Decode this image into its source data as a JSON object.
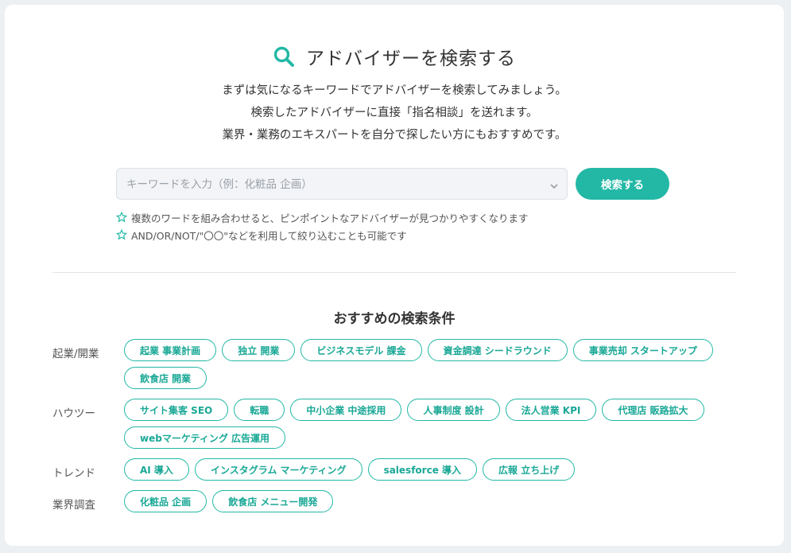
{
  "header": {
    "title": "アドバイザーを検索する",
    "description_lines": [
      "まずは気になるキーワードでアドバイザーを検索してみましょう。",
      "検索したアドバイザーに直接「指名相談」を送れます。",
      "業界・業務のエキスパートを自分で探したい方にもおすすめです。"
    ],
    "icon": "search-icon"
  },
  "search": {
    "placeholder": "キーワードを入力（例：化粧品 企画）",
    "value": "",
    "button_label": "検索する"
  },
  "tips": [
    "複数のワードを組み合わせると、ピンポイントなアドバイザーが見つかりやすくなります",
    "AND/OR/NOT/\"〇〇\"などを利用して絞り込むことも可能です"
  ],
  "recommend": {
    "title": "おすすめの検索条件",
    "categories": [
      {
        "label": "起業/開業",
        "chips": [
          "起業 事業計画",
          "独立 開業",
          "ビジネスモデル 課金",
          "資金調達 シードラウンド",
          "事業売却 スタートアップ",
          "飲食店 開業"
        ]
      },
      {
        "label": "ハウツー",
        "chips": [
          "サイト集客 SEO",
          "転職",
          "中小企業 中途採用",
          "人事制度 設計",
          "法人営業 KPI",
          "代理店 販路拡大",
          "webマーケティング 広告運用"
        ]
      },
      {
        "label": "トレンド",
        "chips": [
          "AI 導入",
          "インスタグラム マーケティング",
          "salesforce 導入",
          "広報 立ち上げ"
        ]
      },
      {
        "label": "業界調査",
        "chips": [
          "化粧品 企画",
          "飲食店 メニュー開発"
        ]
      }
    ]
  },
  "colors": {
    "accent": "#22b8a5",
    "background": "#edf0f3",
    "card": "#ffffff"
  }
}
